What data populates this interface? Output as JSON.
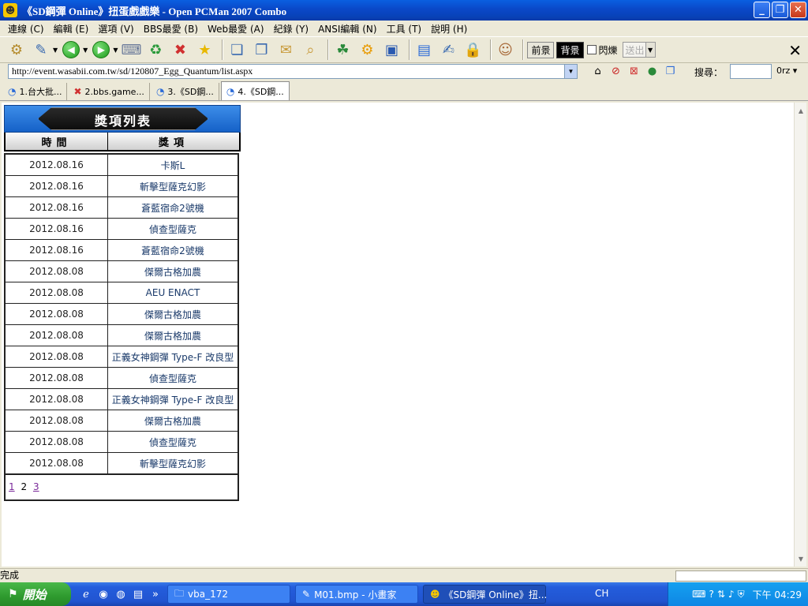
{
  "window": {
    "title": "《SD鋼彈 Online》扭蛋戲戲樂 - Open PCMan 2007 Combo",
    "app_icon": "app-logo-icon"
  },
  "menu": [
    "連線 (C)",
    "編輯 (E)",
    "選項 (V)",
    "BBS最愛 (B)",
    "Web最愛 (A)",
    "紀錄 (Y)",
    "ANSI編輯 (N)",
    "工具 (T)",
    "說明 (H)"
  ],
  "toolbar": {
    "fg_label": "前景",
    "bg_label": "背景",
    "blink_label": "閃爍",
    "send_label": "送出"
  },
  "address": {
    "url": "http://event.wasabii.com.tw/sd/120807_Egg_Quantum/list.aspx",
    "search_label": "搜尋：",
    "search_value": "",
    "engine": "0rz"
  },
  "tabs": [
    {
      "label": "1.台大批..."
    },
    {
      "label": "2.bbs.game..."
    },
    {
      "label": "3.《SD鋼..."
    },
    {
      "label": "4.《SD鋼..."
    }
  ],
  "prize_list": {
    "title": "獎項列表",
    "col_time": "時間",
    "col_prize": "獎項",
    "rows": [
      {
        "time": "2012.08.16",
        "prize": "卡斯L"
      },
      {
        "time": "2012.08.16",
        "prize": "斬擊型薩克幻影"
      },
      {
        "time": "2012.08.16",
        "prize": "蒼藍宿命2號機"
      },
      {
        "time": "2012.08.16",
        "prize": "偵查型薩克"
      },
      {
        "time": "2012.08.16",
        "prize": "蒼藍宿命2號機"
      },
      {
        "time": "2012.08.08",
        "prize": "傑爾古格加農"
      },
      {
        "time": "2012.08.08",
        "prize": "AEU ENACT"
      },
      {
        "time": "2012.08.08",
        "prize": "傑爾古格加農"
      },
      {
        "time": "2012.08.08",
        "prize": "傑爾古格加農"
      },
      {
        "time": "2012.08.08",
        "prize": "正義女神鋼彈 Type-F 改良型"
      },
      {
        "time": "2012.08.08",
        "prize": "偵查型薩克"
      },
      {
        "time": "2012.08.08",
        "prize": "正義女神鋼彈 Type-F 改良型"
      },
      {
        "time": "2012.08.08",
        "prize": "傑爾古格加農"
      },
      {
        "time": "2012.08.08",
        "prize": "偵查型薩克"
      },
      {
        "time": "2012.08.08",
        "prize": "斬擊型薩克幻影"
      }
    ],
    "pages": [
      "1",
      "2",
      "3"
    ],
    "current_page": "2"
  },
  "status": {
    "text": "完成"
  },
  "taskbar": {
    "start_label": "開始",
    "tasks": [
      {
        "label": "vba_172"
      },
      {
        "label": "M01.bmp - 小畫家"
      },
      {
        "label": "《SD鋼彈 Online》扭..."
      }
    ],
    "ime": "CH",
    "clock": "下午 04:29"
  }
}
